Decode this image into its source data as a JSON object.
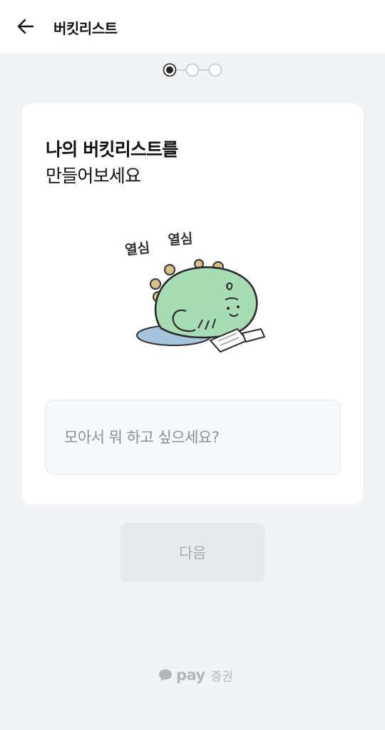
{
  "header": {
    "title": "버킷리스트",
    "back_icon": "arrow-left-icon"
  },
  "stepper": {
    "total_steps": 3,
    "current_step": 1
  },
  "card": {
    "title_strong": "나의 버킷리스트를",
    "title_light": "만들어보세요",
    "illustration": {
      "text_left": "열심",
      "text_right": "열심",
      "colors": {
        "body": "#a8dcb5",
        "outline": "#2b2b2b",
        "spikes": "#d9c08a",
        "puddle": "#a7c4dd"
      }
    },
    "input": {
      "value": "",
      "placeholder": "모아서 뭐 하고 싶으세요?"
    }
  },
  "actions": {
    "next_label": "다음"
  },
  "footer": {
    "brand_icon": "speech-bubble-icon",
    "brand_pay": "pay",
    "brand_sub": "증권"
  },
  "colors": {
    "background": "#f2f3f5",
    "card": "#ffffff",
    "button_disabled_bg": "#e8e9ec",
    "button_disabled_text": "#a9adb3",
    "footer_brand": "#b3b6bb"
  }
}
